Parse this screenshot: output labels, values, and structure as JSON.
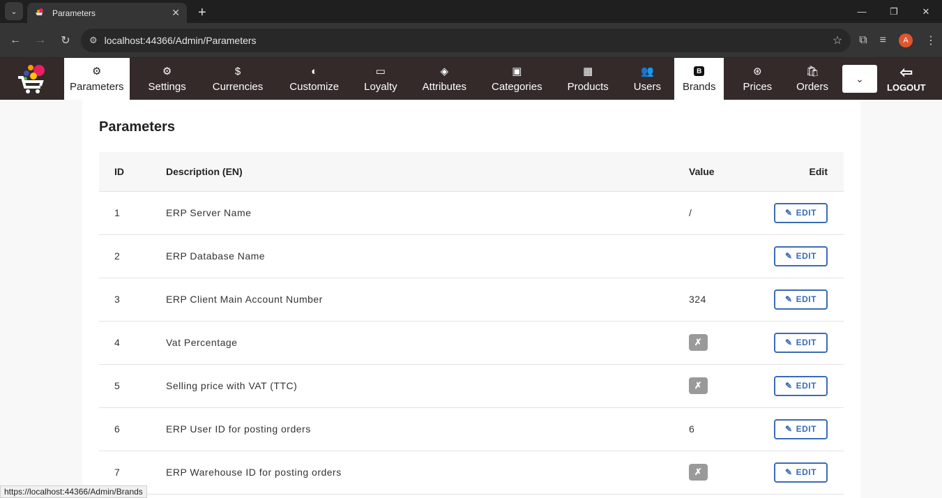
{
  "browser": {
    "tab_title": "Parameters",
    "url": "localhost:44366/Admin/Parameters"
  },
  "appnav": {
    "items": [
      {
        "label": "Parameters",
        "icon": "gear-outline-icon"
      },
      {
        "label": "Settings",
        "icon": "gear-icon"
      },
      {
        "label": "Currencies",
        "icon": "coins-icon"
      },
      {
        "label": "Customize",
        "icon": "edge-icon"
      },
      {
        "label": "Loyalty",
        "icon": "card-icon"
      },
      {
        "label": "Attributes",
        "icon": "diamond-icon"
      },
      {
        "label": "Categories",
        "icon": "collection-icon"
      },
      {
        "label": "Products",
        "icon": "box-icon"
      },
      {
        "label": "Users",
        "icon": "people-icon"
      },
      {
        "label": "Brands",
        "icon": "b-square-icon",
        "letter": "B"
      },
      {
        "label": "Prices",
        "icon": "dollar-circle-icon"
      },
      {
        "label": "Orders",
        "icon": "bag-icon"
      }
    ],
    "logout_label": "LOGOUT"
  },
  "page": {
    "title": "Parameters",
    "columns": {
      "id": "ID",
      "description": "Description (EN)",
      "value": "Value",
      "edit": "Edit"
    },
    "edit_label": "EDIT",
    "rows": [
      {
        "id": "1",
        "description": "ERP Server Name",
        "value": "/",
        "value_type": "text"
      },
      {
        "id": "2",
        "description": "ERP Database Name",
        "value": "",
        "value_type": "text"
      },
      {
        "id": "3",
        "description": "ERP Client Main Account Number",
        "value": "324",
        "value_type": "text"
      },
      {
        "id": "4",
        "description": "Vat Percentage",
        "value": "✗",
        "value_type": "badge"
      },
      {
        "id": "5",
        "description": "Selling price with VAT (TTC)",
        "value": "✗",
        "value_type": "badge"
      },
      {
        "id": "6",
        "description": "ERP User ID for posting orders",
        "value": "6",
        "value_type": "text"
      },
      {
        "id": "7",
        "description": "ERP Warehouse ID for posting orders",
        "value": "✗",
        "value_type": "badge"
      }
    ]
  },
  "statusbar": {
    "text": "https://localhost:44366/Admin/Brands"
  }
}
